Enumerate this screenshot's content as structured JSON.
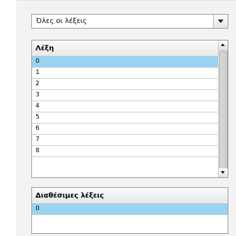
{
  "filter": {
    "selected": "Όλες οι λέξεις"
  },
  "words_list": {
    "header": "Λέξη",
    "rows": [
      "0",
      "1",
      "2",
      "3",
      "4",
      "5",
      "6",
      "7",
      "8"
    ],
    "selected_index": 0
  },
  "available_list": {
    "header": "Διαθέσιμες λέξεις",
    "rows": [
      "0"
    ],
    "selected_index": 0
  },
  "colors": {
    "selection": "#99d4f3",
    "panel": "#f3f3f3"
  },
  "icons": {
    "dropdown": "chevron-down-icon",
    "scroll_up": "arrow-up-icon",
    "scroll_down": "arrow-down-icon"
  }
}
